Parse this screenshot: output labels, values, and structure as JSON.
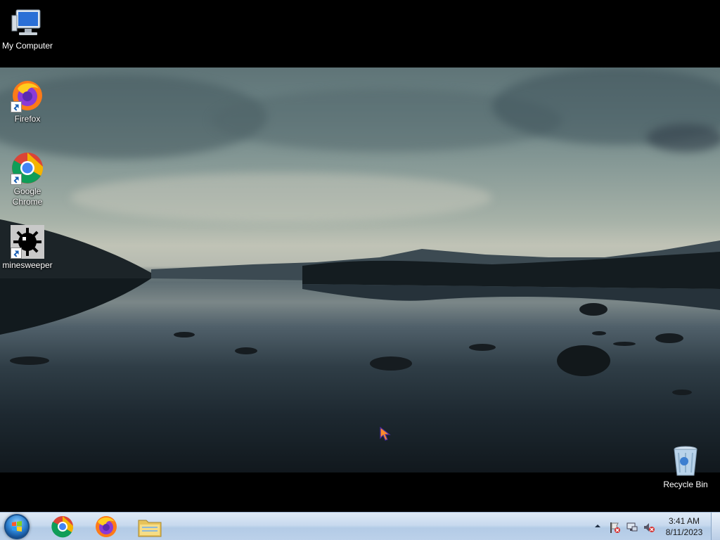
{
  "desktop": {
    "icons": {
      "my_computer": "My Computer",
      "firefox": "Firefox",
      "chrome": "Google Chrome",
      "minesweeper": "minesweeper",
      "recycle_bin": "Recycle Bin"
    }
  },
  "taskbar": {
    "pinned": [
      "chrome-icon",
      "firefox-icon",
      "file-explorer-icon"
    ],
    "tray_icons": [
      "show-hidden-icons-arrow",
      "action-center-flag-icon",
      "network-icon",
      "volume-muted-icon"
    ],
    "clock": {
      "time": "3:41 AM",
      "date": "8/11/2023"
    }
  },
  "colors": {
    "taskbar": "#c7d9ee",
    "start_orb": "#2a7fd0",
    "desktop_text": "#ffffff"
  }
}
